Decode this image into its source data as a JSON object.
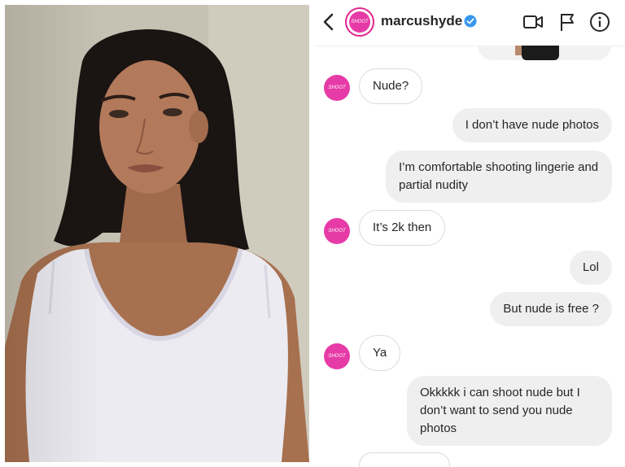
{
  "photo": {
    "subject": "portrait"
  },
  "header": {
    "username": "marcushyde",
    "avatar_text": "SHOOT",
    "icons": [
      "back-chevron-icon",
      "verified-badge-icon",
      "video-call-icon",
      "flag-icon",
      "info-icon"
    ]
  },
  "messages": [
    {
      "from": "them",
      "text": "Nude?"
    },
    {
      "from": "me",
      "text": "I don’t have nude photos"
    },
    {
      "from": "me",
      "text": "I’m comfortable shooting lingerie and partial nudity"
    },
    {
      "from": "them",
      "text": "It’s 2k then"
    },
    {
      "from": "me",
      "text": "Lol"
    },
    {
      "from": "me",
      "text": "But nude is free ?"
    },
    {
      "from": "them",
      "text": "Ya"
    },
    {
      "from": "me",
      "text": "Okkkkk i can shoot nude but I don’t want to send you nude photos"
    }
  ],
  "colors": {
    "accent": "#e63ba7",
    "verified": "#3897f0",
    "bubble_out": "#efefef",
    "border": "#dbdbdb"
  }
}
